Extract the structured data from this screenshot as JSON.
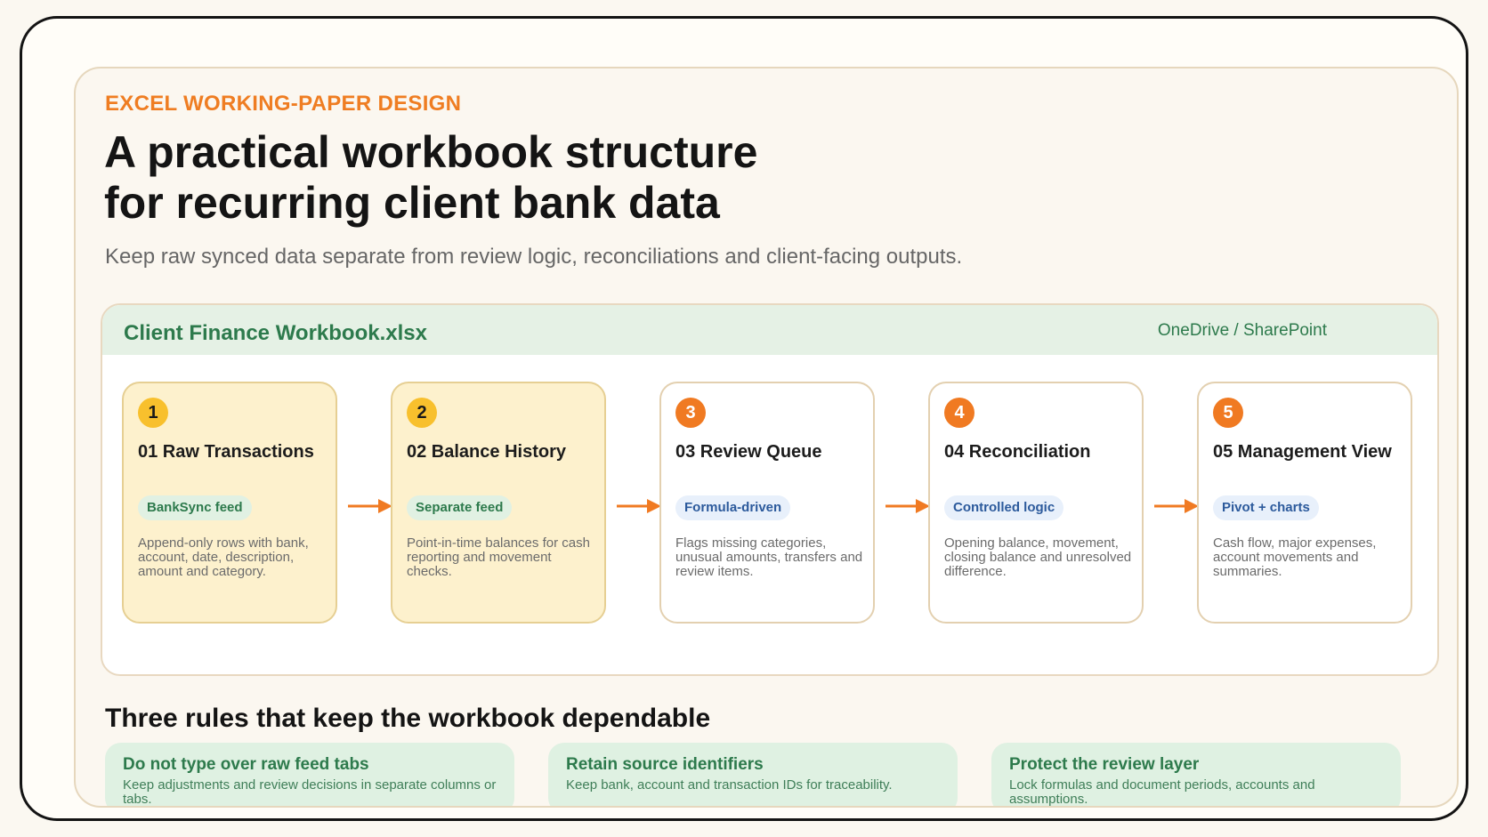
{
  "eyebrow": "EXCEL WORKING-PAPER DESIGN",
  "title": {
    "line1": "A practical workbook structure",
    "line2": "for recurring client bank data"
  },
  "subtitle": "Keep raw synced data separate from review logic, reconciliations and client-facing outputs.",
  "workbook": {
    "name": "Client Finance Workbook.xlsx",
    "location": "OneDrive / SharePoint",
    "steps": [
      {
        "number": "1",
        "title": "01 Raw Transactions",
        "tag": "BankSync feed",
        "description": "Append-only rows with bank, account, date, description, amount and category."
      },
      {
        "number": "2",
        "title": "02 Balance History",
        "tag": "Separate feed",
        "description": "Point-in-time balances for cash reporting and movement checks."
      },
      {
        "number": "3",
        "title": "03 Review Queue",
        "tag": "Formula-driven",
        "description": "Flags missing categories, unusual amounts, transfers and review items."
      },
      {
        "number": "4",
        "title": "04 Reconciliation",
        "tag": "Controlled logic",
        "description": "Opening balance, movement, closing balance and unresolved difference."
      },
      {
        "number": "5",
        "title": "05 Management View",
        "tag": "Pivot + charts",
        "description": "Cash flow, major expenses, account movements and summaries."
      }
    ]
  },
  "rules": {
    "heading": "Three rules that keep the workbook dependable",
    "items": [
      {
        "title": "Do not type over raw feed tabs",
        "description": "Keep adjustments and review decisions in separate columns or tabs."
      },
      {
        "title": "Retain source identifiers",
        "description": "Keep bank, account and transaction IDs for traceability."
      },
      {
        "title": "Protect the review layer",
        "description": "Lock formulas and document periods, accounts and assumptions."
      }
    ]
  },
  "colors": {
    "accent_orange": "#ef7d22",
    "feed_yellow": "#f8c02d",
    "green_text": "#2d7a4c",
    "blue_text": "#2c5a9c"
  }
}
